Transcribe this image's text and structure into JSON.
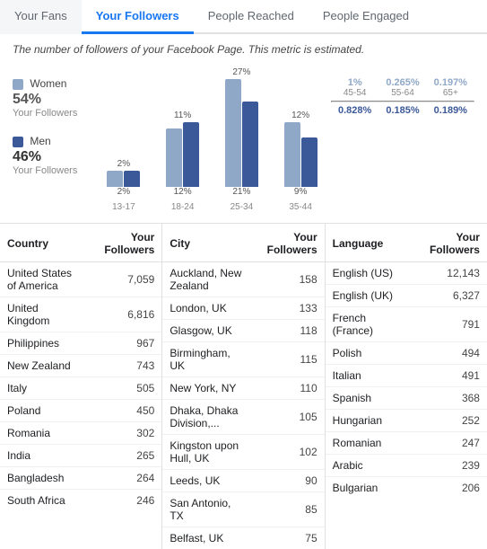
{
  "tabs": [
    {
      "label": "Your Fans",
      "active": false
    },
    {
      "label": "Your Followers",
      "active": true
    },
    {
      "label": "People Reached",
      "active": false
    },
    {
      "label": "People Engaged",
      "active": false
    }
  ],
  "description": "The number of followers of your Facebook Page. This metric is estimated.",
  "legend": {
    "women_label": "Women",
    "women_pct": "54%",
    "women_sub": "Your Followers",
    "men_label": "Men",
    "men_pct": "46%",
    "men_sub": "Your Followers"
  },
  "bars": [
    {
      "age": "13-17",
      "women_pct": "2%",
      "men_pct": "2%",
      "women_h": 18,
      "men_h": 18
    },
    {
      "age": "18-24",
      "women_pct": "11%",
      "men_pct": "12%",
      "women_h": 65,
      "men_h": 72
    },
    {
      "age": "25-34",
      "women_pct": "27%",
      "men_pct": "21%",
      "women_h": 120,
      "men_h": 95
    },
    {
      "age": "35-44",
      "women_pct": "12%",
      "men_pct": "9%",
      "women_h": 72,
      "men_h": 55
    }
  ],
  "side_stats": {
    "top_row": [
      {
        "age": "45-54",
        "women_pct": "1%",
        "men_pct": "0.828%"
      },
      {
        "age": "55-64",
        "women_pct": "0.265%",
        "men_pct": "0.185%"
      },
      {
        "age": "65+",
        "women_pct": "0.197%",
        "men_pct": "0.189%"
      }
    ]
  },
  "country_table": {
    "col1_header": "Country",
    "col2_header": "Your Followers",
    "rows": [
      {
        "name": "United States of America",
        "value": "7,059"
      },
      {
        "name": "United Kingdom",
        "value": "6,816"
      },
      {
        "name": "Philippines",
        "value": "967"
      },
      {
        "name": "New Zealand",
        "value": "743"
      },
      {
        "name": "Italy",
        "value": "505"
      },
      {
        "name": "Poland",
        "value": "450"
      },
      {
        "name": "Romania",
        "value": "302"
      },
      {
        "name": "India",
        "value": "265"
      },
      {
        "name": "Bangladesh",
        "value": "264"
      },
      {
        "name": "South Africa",
        "value": "246"
      }
    ]
  },
  "city_table": {
    "col1_header": "City",
    "col2_header": "Your Followers",
    "rows": [
      {
        "name": "Auckland, New Zealand",
        "value": "158"
      },
      {
        "name": "London, UK",
        "value": "133"
      },
      {
        "name": "Glasgow, UK",
        "value": "118"
      },
      {
        "name": "Birmingham, UK",
        "value": "115"
      },
      {
        "name": "New York, NY",
        "value": "110"
      },
      {
        "name": "Dhaka, Dhaka Division,...",
        "value": "105"
      },
      {
        "name": "Kingston upon Hull, UK",
        "value": "102"
      },
      {
        "name": "Leeds, UK",
        "value": "90"
      },
      {
        "name": "San Antonio, TX",
        "value": "85"
      },
      {
        "name": "Belfast, UK",
        "value": "75"
      }
    ]
  },
  "language_table": {
    "col1_header": "Language",
    "col2_header": "Your Followers",
    "rows": [
      {
        "name": "English (US)",
        "value": "12,143"
      },
      {
        "name": "English (UK)",
        "value": "6,327"
      },
      {
        "name": "French (France)",
        "value": "791"
      },
      {
        "name": "Polish",
        "value": "494"
      },
      {
        "name": "Italian",
        "value": "491"
      },
      {
        "name": "Spanish",
        "value": "368"
      },
      {
        "name": "Hungarian",
        "value": "252"
      },
      {
        "name": "Romanian",
        "value": "247"
      },
      {
        "name": "Arabic",
        "value": "239"
      },
      {
        "name": "Bulgarian",
        "value": "206"
      }
    ]
  }
}
